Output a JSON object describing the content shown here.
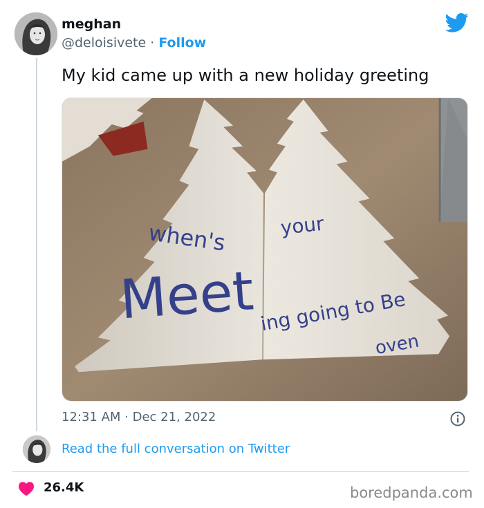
{
  "tweet": {
    "user": {
      "name": "meghan",
      "handle": "@deloisivete",
      "separator": " · ",
      "follow_label": "Follow"
    },
    "text": "My kid came up with a new holiday greeting",
    "image": {
      "handwriting": {
        "line1a": "when's",
        "line1b": "your",
        "line2": "Meet",
        "line2b": "ing going to Be",
        "line3": "oven"
      }
    },
    "timestamp": "12:31 AM · Dec 21, 2022",
    "read_more_label": "Read the full conversation on Twitter",
    "like_count": "26.4K"
  },
  "watermark": "boredpanda.com",
  "colors": {
    "accent": "#1d9bf0",
    "like": "#f91880",
    "text_primary": "#0f1419",
    "text_secondary": "#536471"
  },
  "icons": {
    "logo": "twitter-bird-icon",
    "info": "info-icon",
    "like": "heart-icon"
  }
}
